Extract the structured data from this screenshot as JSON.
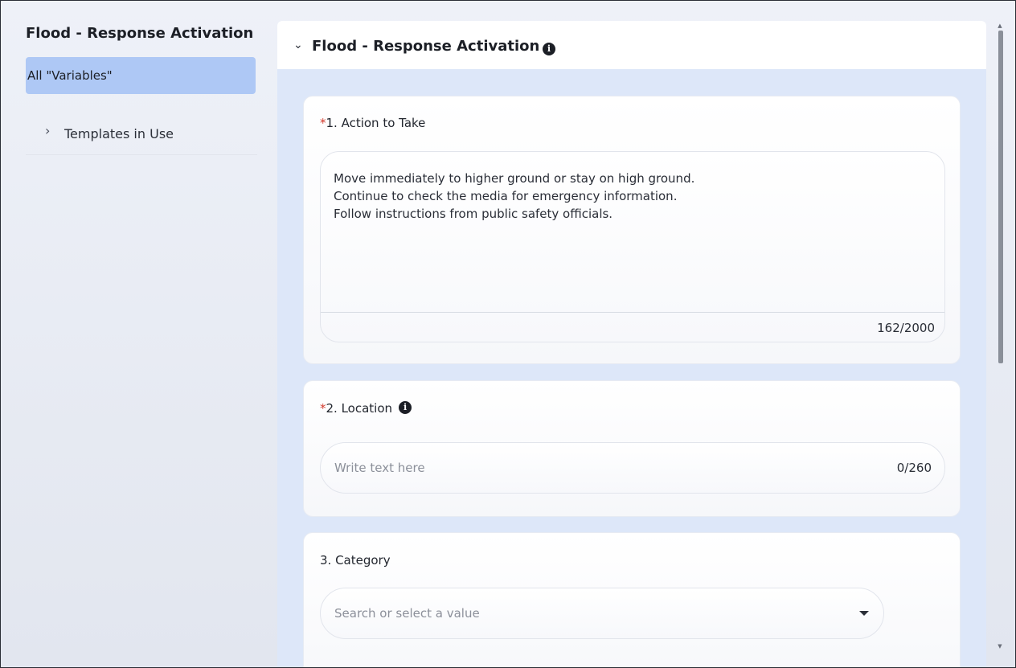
{
  "sidebar": {
    "title": "Flood - Response Activation",
    "active_item": "All \"Variables\"",
    "items": [
      {
        "label": "Templates in Use",
        "icon": "chevron-right-icon"
      }
    ]
  },
  "panel": {
    "title": "Flood - Response Activation",
    "collapse_icon": "chevron-down-icon",
    "info_icon": "info-icon"
  },
  "fields": {
    "action": {
      "required_mark": "*",
      "label": "1. Action to Take",
      "value": "Move immediately to higher ground or stay on high ground.\nContinue to check the media for emergency information.\nFollow instructions from public safety officials.",
      "counter": "162/2000"
    },
    "location": {
      "required_mark": "*",
      "label": "2. Location",
      "placeholder": "Write text here",
      "counter": "0/260"
    },
    "category": {
      "label": "3. Category",
      "placeholder": "Search or select a value"
    }
  },
  "colors": {
    "sidebar_active_bg": "#aec8f5",
    "panel_bg": "#dde7f9",
    "required": "#d33a2c"
  },
  "icons": {
    "info": "i",
    "chevron_right": "›",
    "chevron_down": "ˇ",
    "scroll_up": "▲",
    "scroll_down": "▼"
  }
}
